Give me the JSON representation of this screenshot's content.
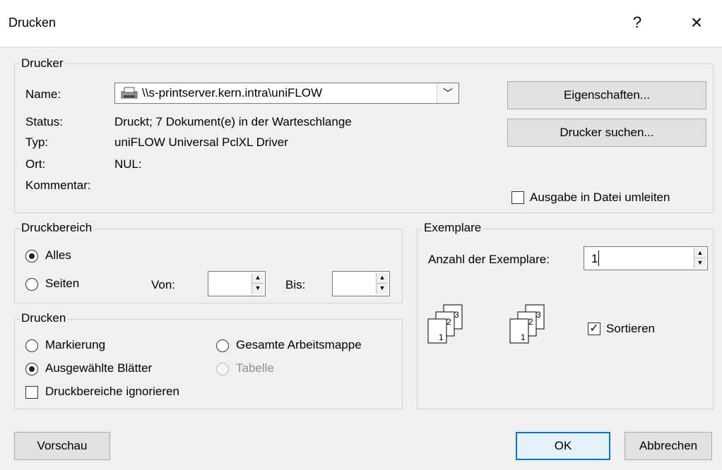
{
  "window": {
    "title": "Drucken",
    "help": "?",
    "close": "×"
  },
  "printer": {
    "legend": "Drucker",
    "name_label": "Name:",
    "name_value": "\\\\s-printserver.kern.intra\\uniFLOW",
    "status_label": "Status:",
    "status_value": "Druckt; 7 Dokument(e) in der Warteschlange",
    "type_label": "Typ:",
    "type_value": "uniFLOW Universal PclXL Driver",
    "location_label": "Ort:",
    "location_value": "NUL:",
    "comment_label": "Kommentar:",
    "properties_button": "Eigenschaften...",
    "find_button": "Drucker suchen...",
    "print_to_file": "Ausgabe in Datei umleiten",
    "print_to_file_checked": false
  },
  "print_range": {
    "legend": "Druckbereich",
    "all": "Alles",
    "pages": "Seiten",
    "from": "Von:",
    "to": "Bis:",
    "from_value": "",
    "to_value": "",
    "selected": "all"
  },
  "print_what": {
    "legend": "Drucken",
    "selection": "Markierung",
    "entire_workbook": "Gesamte Arbeitsmappe",
    "active_sheets": "Ausgewählte Blätter",
    "table": "Tabelle",
    "ignore_areas": "Druckbereiche ignorieren",
    "selected": "active_sheets",
    "ignore_areas_checked": false
  },
  "copies": {
    "legend": "Exemplare",
    "count_label": "Anzahl der Exemplare:",
    "count_value": "1",
    "collate": "Sortieren",
    "collate_checked": true
  },
  "footer": {
    "preview": "Vorschau",
    "ok": "OK",
    "cancel": "Abbrechen"
  },
  "icons": {
    "printer": "printer-icon",
    "combo_arrow": "chevron-down-icon",
    "spin_up": "▲",
    "spin_down": "▼",
    "check": "✓"
  }
}
